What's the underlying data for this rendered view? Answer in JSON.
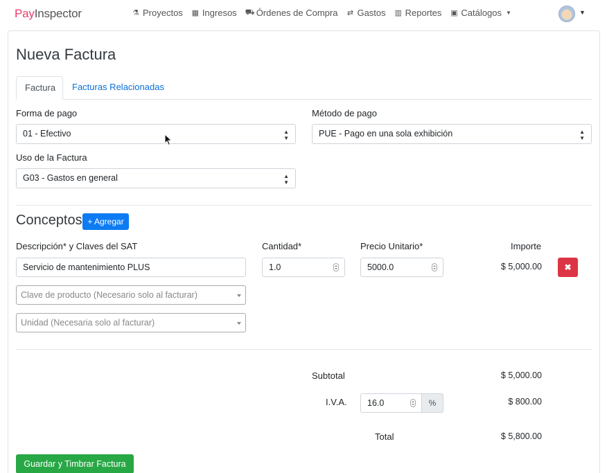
{
  "brand": {
    "pay": "Pay",
    "inspector": "Inspector"
  },
  "nav": [
    {
      "icon": "flask-icon",
      "glyph": "⚗",
      "label": "Proyectos"
    },
    {
      "icon": "calculator-icon",
      "glyph": "▦",
      "label": "Ingresos"
    },
    {
      "icon": "shopping-basket-icon",
      "glyph": "⛟",
      "label": "Órdenes de Compra"
    },
    {
      "icon": "exchange-icon",
      "glyph": "⇄",
      "label": "Gastos"
    },
    {
      "icon": "bar-chart-icon",
      "glyph": "▥",
      "label": "Reportes"
    },
    {
      "icon": "archive-icon",
      "glyph": "▣",
      "label": "Catálogos"
    }
  ],
  "page": {
    "title": "Nueva Factura"
  },
  "tabs": [
    {
      "label": "Factura"
    },
    {
      "label": "Facturas Relacionadas"
    }
  ],
  "form": {
    "forma_pago": {
      "label": "Forma de pago",
      "value": "01 - Efectivo"
    },
    "metodo_pago": {
      "label": "Método de pago",
      "value": "PUE - Pago en una sola exhibición"
    },
    "uso": {
      "label": "Uso de la Factura",
      "value": "G03 - Gastos en general"
    }
  },
  "conceptos": {
    "title": "Conceptos",
    "add_label": "+ Agregar",
    "headers": {
      "descripcion": "Descripción* y Claves del SAT",
      "cantidad": "Cantidad*",
      "precio": "Precio Unitario*",
      "importe": "Importe"
    },
    "item": {
      "descripcion": "Servicio de mantenimiento PLUS",
      "cantidad": "1.0",
      "precio": "5000.0",
      "importe": "$ 5,000.00",
      "clave_placeholder": "Clave de producto (Necesario solo al facturar)",
      "unidad_placeholder": "Unidad (Necesaria solo al facturar)"
    }
  },
  "totals": {
    "subtotal_label": "Subtotal",
    "subtotal": "$ 5,000.00",
    "iva_label": "I.V.A.",
    "iva_rate": "16.0",
    "iva_unit": "%",
    "iva": "$ 800.00",
    "total_label": "Total",
    "total": "$ 5,800.00"
  },
  "actions": {
    "save_label": "Guardar y Timbrar Factura"
  }
}
